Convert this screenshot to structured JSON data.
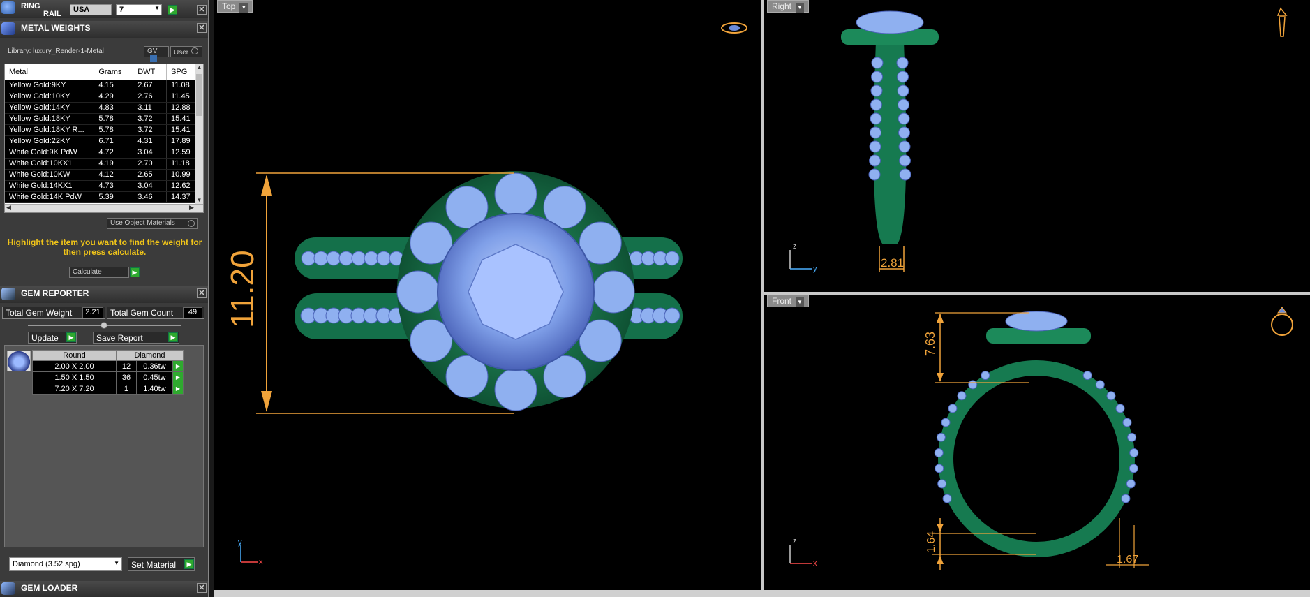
{
  "ring_rail": {
    "title_line1": "RING",
    "title_line2": "RAIL",
    "country": "USA",
    "size": "7"
  },
  "metal_weights": {
    "title": "METAL WEIGHTS",
    "library": "Library: luxury_Render-1-Metal",
    "gv_label": "GV",
    "user_label": "User",
    "columns": [
      "Metal",
      "Grams",
      "DWT",
      "SPG"
    ],
    "rows": [
      [
        "Yellow Gold:9KY",
        "4.15",
        "2.67",
        "11.08"
      ],
      [
        "Yellow Gold:10KY",
        "4.29",
        "2.76",
        "11.45"
      ],
      [
        "Yellow Gold:14KY",
        "4.83",
        "3.11",
        "12.88"
      ],
      [
        "Yellow Gold:18KY",
        "5.78",
        "3.72",
        "15.41"
      ],
      [
        "Yellow Gold:18KY R...",
        "5.78",
        "3.72",
        "15.41"
      ],
      [
        "Yellow Gold:22KY",
        "6.71",
        "4.31",
        "17.89"
      ],
      [
        "White Gold:9K PdW",
        "4.72",
        "3.04",
        "12.59"
      ],
      [
        "White Gold:10KX1",
        "4.19",
        "2.70",
        "11.18"
      ],
      [
        "White Gold:10KW",
        "4.12",
        "2.65",
        "10.99"
      ],
      [
        "White Gold:14KX1",
        "4.73",
        "3.04",
        "12.62"
      ],
      [
        "White Gold:14K PdW",
        "5.39",
        "3.46",
        "14.37"
      ]
    ],
    "use_object_materials": "Use Object Materials",
    "message": "Highlight the item you want to find the weight for then press calculate.",
    "calculate": "Calculate"
  },
  "gem_reporter": {
    "title": "GEM REPORTER",
    "total_weight_label": "Total Gem Weight",
    "total_weight": "2.21",
    "total_count_label": "Total Gem Count",
    "total_count": "49",
    "update": "Update",
    "save_report": "Save Report",
    "columns": [
      "Round",
      "Diamond"
    ],
    "rows": [
      [
        "2.00 X 2.00",
        "12",
        "0.36tw"
      ],
      [
        "1.50 X 1.50",
        "36",
        "0.45tw"
      ],
      [
        "7.20 X 7.20",
        "1",
        "1.40tw"
      ]
    ],
    "material_select": "Diamond     (3.52 spg)",
    "set_material": "Set Material"
  },
  "gem_loader": {
    "title": "GEM LOADER"
  },
  "viewports": {
    "top": {
      "label": "Top",
      "dimension": "11.20",
      "axis_y": "y",
      "axis_x": "x"
    },
    "right": {
      "label": "Right",
      "dimension": "2.81",
      "axis_z": "z",
      "axis_y": "y"
    },
    "front": {
      "label": "Front",
      "dim_height": "7.63",
      "dim_bottom": "1.64",
      "dim_shank": "1.67",
      "axis_z": "z",
      "axis_x": "x"
    }
  },
  "colors": {
    "metal_green": "#1f8a5a",
    "gem_blue": "#8fb0f0",
    "dimension_orange": "#f0a33a",
    "highlight_yellow": "#f0c419"
  }
}
